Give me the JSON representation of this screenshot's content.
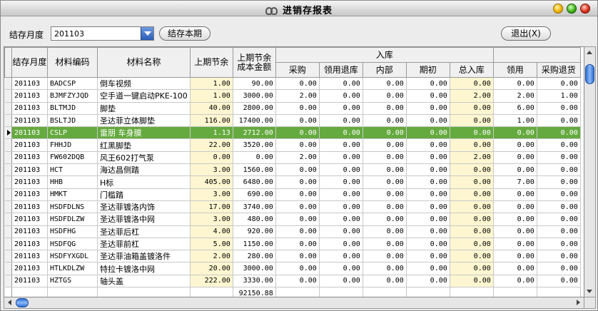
{
  "window": {
    "title": "进销存报表"
  },
  "toolbar": {
    "month_label": "结存月度",
    "month_value": "201103",
    "close_period_label": "结存本期",
    "exit_label": "退出(X)"
  },
  "table": {
    "headers": {
      "month": "结存月度",
      "code": "材料编码",
      "name": "材料名称",
      "prev_qty": "上期节余",
      "prev_amount": "上期节余成本金额",
      "inbound_group": "入库",
      "purchase": "采购",
      "return_from_use": "领用退库",
      "internal": "内部",
      "opening": "期初",
      "total_in": "总入库",
      "use": "领用",
      "purchase_return": "采购退货"
    },
    "rows": [
      {
        "month": "201103",
        "code": "BADCSP",
        "name": "倒车视频",
        "prev_qty": "1.00",
        "prev_amount": "90.00",
        "purchase": "0.00",
        "return_from_use": "0.00",
        "internal": "0.00",
        "opening": "0.00",
        "total_in": "0.00",
        "use": "0.00",
        "purchase_return": "0.00"
      },
      {
        "month": "201103",
        "code": "BJMFZYJQD",
        "name": "空手道一键启动PKE-100",
        "prev_qty": "1.00",
        "prev_amount": "3000.00",
        "purchase": "2.00",
        "return_from_use": "0.00",
        "internal": "0.00",
        "opening": "0.00",
        "total_in": "2.00",
        "use": "2.00",
        "purchase_return": "1.00"
      },
      {
        "month": "201103",
        "code": "BLTMJD",
        "name": "脚垫",
        "prev_qty": "40.00",
        "prev_amount": "2800.00",
        "purchase": "0.00",
        "return_from_use": "0.00",
        "internal": "0.00",
        "opening": "0.00",
        "total_in": "0.00",
        "use": "6.00",
        "purchase_return": "0.00"
      },
      {
        "month": "201103",
        "code": "BSLTJD",
        "name": "圣达菲立体脚垫",
        "prev_qty": "116.00",
        "prev_amount": "17400.00",
        "purchase": "0.00",
        "return_from_use": "0.00",
        "internal": "0.00",
        "opening": "0.00",
        "total_in": "0.00",
        "use": "1.00",
        "purchase_return": "0.00"
      },
      {
        "month": "201103",
        "code": "CSLP",
        "name": "雷朋  车身膜",
        "prev_qty": "1.13",
        "prev_amount": "2712.00",
        "purchase": "0.00",
        "return_from_use": "0.00",
        "internal": "0.00",
        "opening": "0.00",
        "total_in": "0.00",
        "use": "0.00",
        "purchase_return": "0.00",
        "selected": true
      },
      {
        "month": "201103",
        "code": "FHHJD",
        "name": "红黑脚垫",
        "prev_qty": "22.00",
        "prev_amount": "3520.00",
        "purchase": "0.00",
        "return_from_use": "0.00",
        "internal": "0.00",
        "opening": "0.00",
        "total_in": "0.00",
        "use": "0.00",
        "purchase_return": "0.00"
      },
      {
        "month": "201103",
        "code": "FW602DQB",
        "name": "风王602打气泵",
        "prev_qty": "0.00",
        "prev_amount": "0.00",
        "purchase": "2.00",
        "return_from_use": "0.00",
        "internal": "0.00",
        "opening": "0.00",
        "total_in": "2.00",
        "use": "0.00",
        "purchase_return": "0.00"
      },
      {
        "month": "201103",
        "code": "HCT",
        "name": "海达昌侧踏",
        "prev_qty": "3.00",
        "prev_amount": "1560.00",
        "purchase": "0.00",
        "return_from_use": "0.00",
        "internal": "0.00",
        "opening": "0.00",
        "total_in": "0.00",
        "use": "0.00",
        "purchase_return": "0.00"
      },
      {
        "month": "201103",
        "code": "HHB",
        "name": "H标",
        "prev_qty": "405.00",
        "prev_amount": "6480.00",
        "purchase": "0.00",
        "return_from_use": "0.00",
        "internal": "0.00",
        "opening": "0.00",
        "total_in": "0.00",
        "use": "7.00",
        "purchase_return": "0.00"
      },
      {
        "month": "201103",
        "code": "HMKT",
        "name": "门槛踏",
        "prev_qty": "3.00",
        "prev_amount": "690.00",
        "purchase": "0.00",
        "return_from_use": "0.00",
        "internal": "0.00",
        "opening": "0.00",
        "total_in": "0.00",
        "use": "0.00",
        "purchase_return": "0.00"
      },
      {
        "month": "201103",
        "code": "HSDFDLNS",
        "name": "圣达菲镀洛内饰",
        "prev_qty": "17.00",
        "prev_amount": "3740.00",
        "purchase": "0.00",
        "return_from_use": "0.00",
        "internal": "0.00",
        "opening": "0.00",
        "total_in": "0.00",
        "use": "0.00",
        "purchase_return": "0.00"
      },
      {
        "month": "201103",
        "code": "HSDFDLZW",
        "name": "圣达菲镀洛中网",
        "prev_qty": "3.00",
        "prev_amount": "480.00",
        "purchase": "0.00",
        "return_from_use": "0.00",
        "internal": "0.00",
        "opening": "0.00",
        "total_in": "0.00",
        "use": "0.00",
        "purchase_return": "0.00"
      },
      {
        "month": "201103",
        "code": "HSDFHG",
        "name": "圣达菲后杠",
        "prev_qty": "4.00",
        "prev_amount": "920.00",
        "purchase": "0.00",
        "return_from_use": "0.00",
        "internal": "0.00",
        "opening": "0.00",
        "total_in": "0.00",
        "use": "0.00",
        "purchase_return": "0.00"
      },
      {
        "month": "201103",
        "code": "HSDFQG",
        "name": "圣达菲前杠",
        "prev_qty": "5.00",
        "prev_amount": "1150.00",
        "purchase": "0.00",
        "return_from_use": "0.00",
        "internal": "0.00",
        "opening": "0.00",
        "total_in": "0.00",
        "use": "0.00",
        "purchase_return": "0.00"
      },
      {
        "month": "201103",
        "code": "HSDFYXGDL",
        "name": "圣达菲油箱盖镀洛件",
        "prev_qty": "2.00",
        "prev_amount": "280.00",
        "purchase": "0.00",
        "return_from_use": "0.00",
        "internal": "0.00",
        "opening": "0.00",
        "total_in": "0.00",
        "use": "0.00",
        "purchase_return": "0.00"
      },
      {
        "month": "201103",
        "code": "HTLKDLZW",
        "name": "特拉卡镀洛中网",
        "prev_qty": "20.00",
        "prev_amount": "3000.00",
        "purchase": "0.00",
        "return_from_use": "0.00",
        "internal": "0.00",
        "opening": "0.00",
        "total_in": "0.00",
        "use": "0.00",
        "purchase_return": "0.00"
      },
      {
        "month": "201103",
        "code": "HZTGS",
        "name": "轴头盖",
        "prev_qty": "222.00",
        "prev_amount": "3330.00",
        "purchase": "0.00",
        "return_from_use": "0.00",
        "internal": "0.00",
        "opening": "0.00",
        "total_in": "0.00",
        "use": "0.00",
        "purchase_return": "0.00"
      }
    ],
    "total_prev_amount": "92150.88"
  },
  "colors": {
    "selected_row": "#65aa3f",
    "highlight_column": "#fdf6d0",
    "scroll_thumb": "#2d6fd6"
  },
  "icons": {
    "title": "link-icon",
    "scroll": [
      "scroll-up-icon",
      "scroll-down-icon",
      "scroll-left-icon",
      "scroll-right-icon"
    ]
  }
}
